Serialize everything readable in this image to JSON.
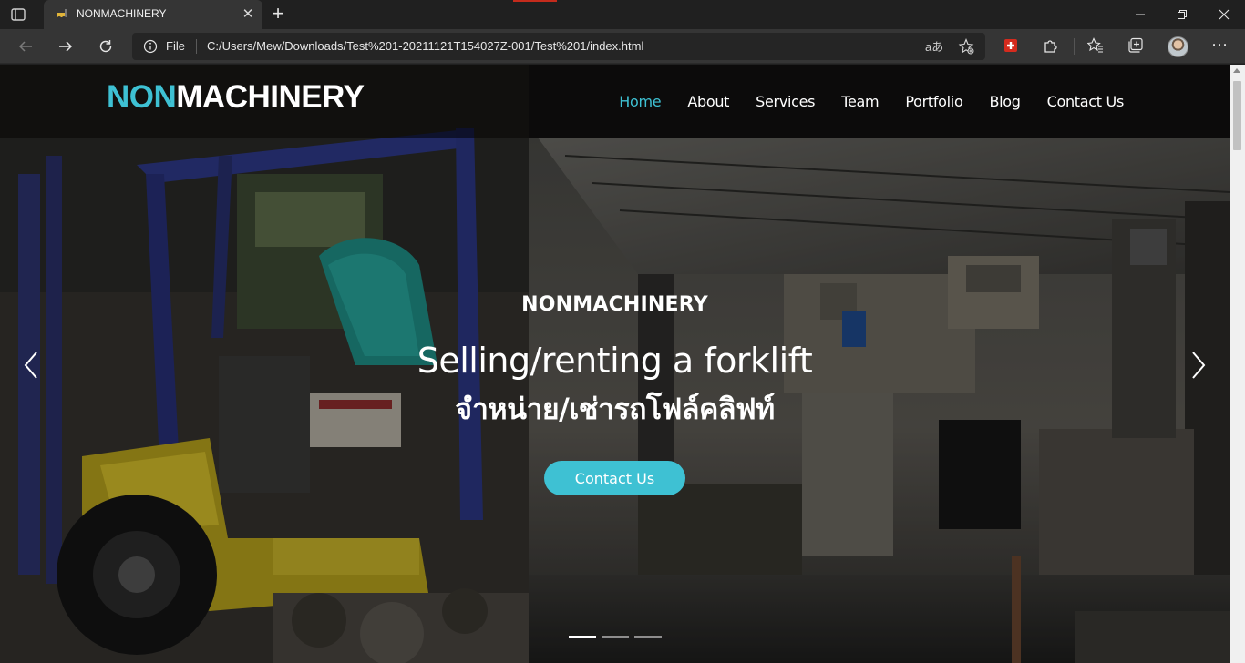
{
  "browser": {
    "tab_title": "NONMACHINERY",
    "address_scheme": "File",
    "url": "C:/Users/Mew/Downloads/Test%201-20211121T154027Z-001/Test%201/index.html",
    "read_aloud_label": "aあ"
  },
  "site": {
    "logo_accent": "NON",
    "logo_rest": "MACHINERY",
    "nav": [
      "Home",
      "About",
      "Services",
      "Team",
      "Portfolio",
      "Blog",
      "Contact Us"
    ],
    "active_nav": "Home"
  },
  "hero": {
    "brand": "NONMACHINERY",
    "headline_en": "Selling/renting a forklift",
    "headline_th": "จำหน่าย/เช่ารถโฟล์คลิฟท์",
    "cta_label": "Contact Us",
    "slides_total": 3,
    "active_slide": 1
  },
  "colors": {
    "accent": "#3ec1d3",
    "chrome_bg": "#202020",
    "toolbar_bg": "#353535"
  }
}
